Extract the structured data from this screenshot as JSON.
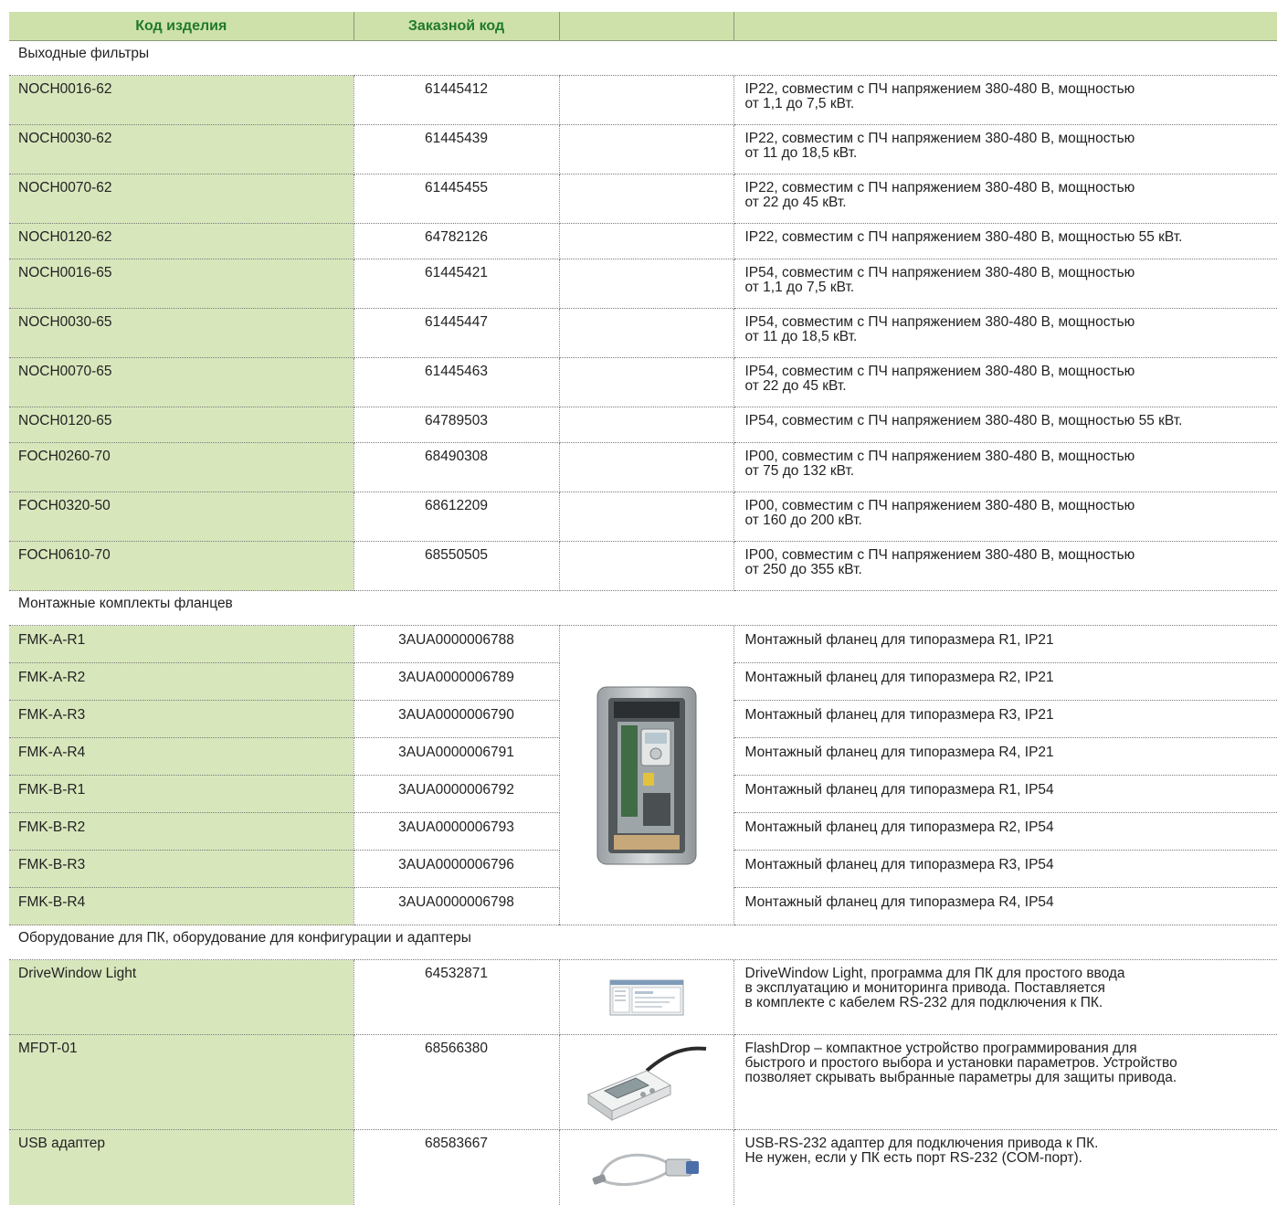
{
  "headers": [
    "Код изделия",
    "Заказной код",
    "",
    ""
  ],
  "sections": {
    "filters": "Выходные фильтры",
    "flanges": "Монтажные комплекты фланцев",
    "pc": "Оборудование для ПК, оборудование для конфигурации и адаптеры"
  },
  "filters": [
    {
      "code": "NOCH0016-62",
      "order": "61445412",
      "desc": "IP22, совместим с ПЧ напряжением 380-480 В, мощностью\nот 1,1 до 7,5 кВт."
    },
    {
      "code": "NOCH0030-62",
      "order": "61445439",
      "desc": "IP22, совместим с ПЧ напряжением 380-480 В, мощностью\nот 11 до 18,5 кВт."
    },
    {
      "code": "NOCH0070-62",
      "order": "61445455",
      "desc": "IP22, совместим с ПЧ напряжением 380-480 В, мощностью\nот 22 до 45 кВт."
    },
    {
      "code": "NOCH0120-62",
      "order": "64782126",
      "desc": "IP22, совместим с ПЧ напряжением 380-480 В, мощностью 55 кВт."
    },
    {
      "code": "NOCH0016-65",
      "order": "61445421",
      "desc": "IP54, совместим с ПЧ напряжением 380-480 В, мощностью\nот 1,1 до 7,5 кВт."
    },
    {
      "code": "NOCH0030-65",
      "order": "61445447",
      "desc": "IP54, совместим с ПЧ напряжением 380-480 В, мощностью\nот 11 до 18,5 кВт."
    },
    {
      "code": "NOCH0070-65",
      "order": "61445463",
      "desc": "IP54, совместим с ПЧ напряжением 380-480 В, мощностью\nот 22 до 45 кВт."
    },
    {
      "code": "NOCH0120-65",
      "order": "64789503",
      "desc": "IP54, совместим с ПЧ напряжением 380-480 В, мощностью 55 кВт."
    },
    {
      "code": "FOCH0260-70",
      "order": "68490308",
      "desc": "IP00, совместим с ПЧ напряжением 380-480 В, мощностью\nот 75 до 132 кВт."
    },
    {
      "code": "FOCH0320-50",
      "order": "68612209",
      "desc": "IP00, совместим с ПЧ напряжением 380-480 В, мощностью\nот 160 до 200 кВт."
    },
    {
      "code": "FOCH0610-70",
      "order": "68550505",
      "desc": "IP00, совместим с ПЧ напряжением 380-480 В, мощностью\nот 250 до 355 кВт."
    }
  ],
  "flanges": [
    {
      "code": "FMK-A-R1",
      "order": "3AUA0000006788",
      "desc": "Монтажный фланец для типоразмера R1, IP21"
    },
    {
      "code": "FMK-A-R2",
      "order": "3AUA0000006789",
      "desc": "Монтажный фланец для типоразмера R2, IP21"
    },
    {
      "code": "FMK-A-R3",
      "order": "3AUA0000006790",
      "desc": "Монтажный фланец для типоразмера R3, IP21"
    },
    {
      "code": "FMK-A-R4",
      "order": "3AUA0000006791",
      "desc": "Монтажный фланец для типоразмера R4, IP21"
    },
    {
      "code": "FMK-B-R1",
      "order": "3AUA0000006792",
      "desc": "Монтажный фланец для типоразмера R1, IP54"
    },
    {
      "code": "FMK-B-R2",
      "order": "3AUA0000006793",
      "desc": "Монтажный фланец для типоразмера R2, IP54"
    },
    {
      "code": "FMK-B-R3",
      "order": "3AUA0000006796",
      "desc": "Монтажный фланец для типоразмера R3, IP54"
    },
    {
      "code": "FMK-B-R4",
      "order": "3AUA0000006798",
      "desc": "Монтажный фланец для типоразмера R4, IP54"
    }
  ],
  "pc": [
    {
      "code": "DriveWindow Light",
      "order": "64532871",
      "image": "software-screenshot",
      "desc": "DriveWindow Light, программа для ПК для простого ввода\nв эксплуатацию и мониторинга привода. Поставляется\nв комплекте с кабелем RS-232 для подключения к ПК."
    },
    {
      "code": "MFDT-01",
      "order": "68566380",
      "image": "flashdrop-device",
      "desc": "FlashDrop – компактное устройство программирования для\nбыстрого и простого выбора и установки параметров. Устройство\nпозволяет скрывать выбранные параметры для защиты привода."
    },
    {
      "code": "USB адаптер",
      "order": "68583667",
      "image": "usb-cable",
      "desc": "USB-RS-232 адаптер для подключения привода к ПК.\nНе нужен, если у ПК есть порт RS-232 (COM-порт)."
    }
  ],
  "flange_image": "drive-flange-photo"
}
